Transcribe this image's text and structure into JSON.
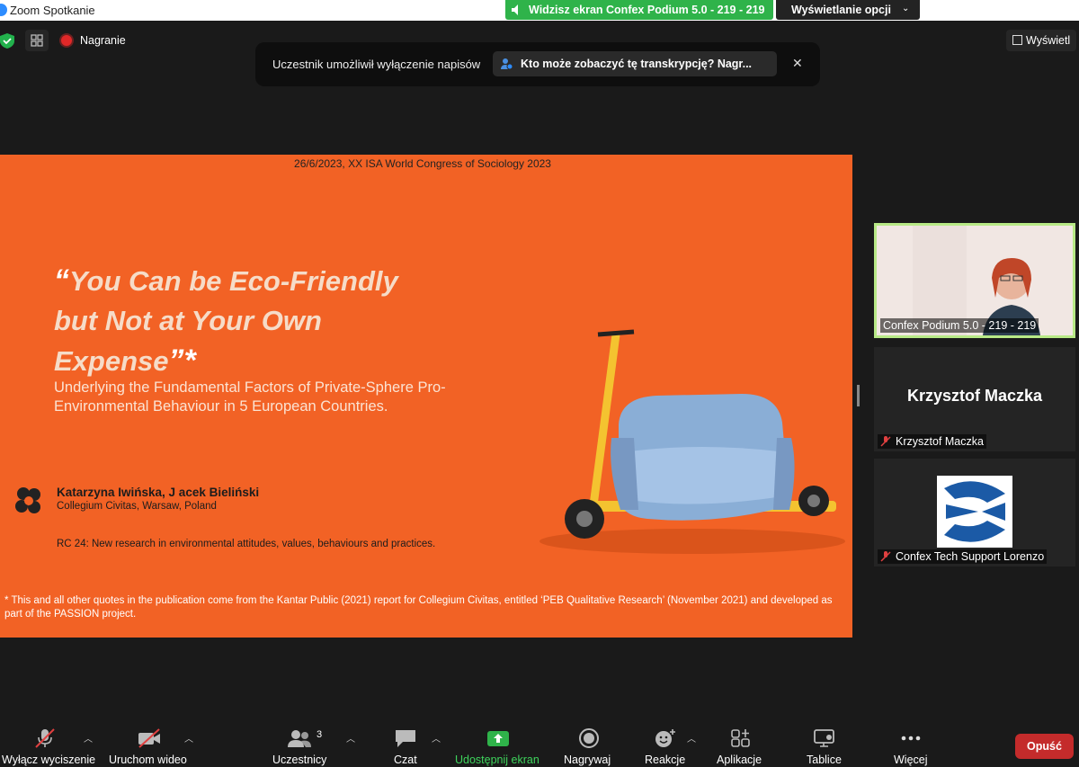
{
  "window": {
    "title": "Zoom Spotkanie"
  },
  "share_banner": {
    "text": "Widzisz ekran Confex Podium 5.0 - 219 - 219",
    "view_options": "Wyświetlanie opcji"
  },
  "topbar": {
    "recording_label": "Nagranie",
    "view_label": "Wyświetl"
  },
  "notification": {
    "message": "Uczestnik umożliwił wyłączenie napisów",
    "chip_text": "Kto może zobaczyć tę transkrypcję? Nagr...",
    "close_glyph": "✕"
  },
  "slide": {
    "date_line": "26/6/2023, XX ISA World Congress of Sociology 2023",
    "title_open_quote": "“",
    "title_line1": "You Can be Eco-Friendly",
    "title_line2": "but Not at Your Own",
    "title_line3": "Expense",
    "title_close": "”*",
    "subtitle_line1": "Underlying the Fundamental Factors of Private-Sphere Pro-",
    "subtitle_line2": "Environmental Behaviour in 5 European Countries.",
    "authors": "Katarzyna Iwińska, J acek Bieliński",
    "affiliation": "Collegium Civitas, Warsaw, Poland",
    "rc": "RC 24: New research in environmental attitudes, values, behaviours and practices.",
    "footnote": "* This and all other quotes in the publication come from the Kantar Public (2021) report for Collegium Civitas, entitled ‘PEB Qualitative Research’ (November 2021) and developed as part of the PASSION project."
  },
  "participants": [
    {
      "name": "Confex Podium 5.0 - 219 - 219"
    },
    {
      "name": "Krzysztof Maczka",
      "display": "Krzysztof Maczka"
    },
    {
      "name": "Confex Tech Support Lorenzo"
    }
  ],
  "toolbar": {
    "mute": "Wyłącz wyciszenie",
    "video": "Uruchom wideo",
    "participants": "Uczestnicy",
    "participants_count": "3",
    "chat": "Czat",
    "share": "Udostępnij ekran",
    "record": "Nagrywaj",
    "reactions": "Reakcje",
    "apps": "Aplikacje",
    "whiteboards": "Tablice",
    "more": "Więcej",
    "leave": "Opuść"
  },
  "colors": {
    "slide_bg": "#f26225",
    "share_green": "#2fb34a",
    "leave_red": "#c42b2b",
    "active_border": "#b8e986"
  }
}
